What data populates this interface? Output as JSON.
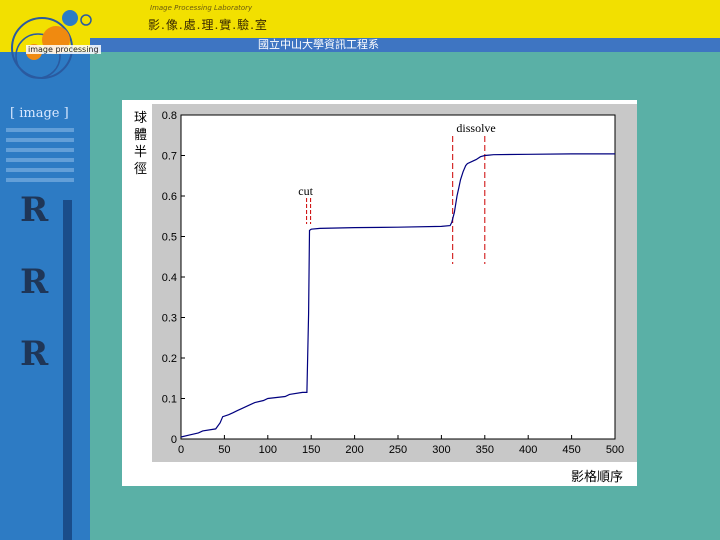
{
  "header": {
    "title": "影.像.處.理.實.驗.室",
    "subtitle": "Image Processing Laboratory",
    "department": "國立中山大學資訊工程系"
  },
  "logo": {
    "text": "image processing"
  },
  "sidebar": {
    "title": "[ image ]"
  },
  "colors": {
    "header": "#f2e000",
    "sidebar": "#2d7bc4",
    "background": "#5ab0a6",
    "curve": "#00007f",
    "markers": "#cc0000"
  },
  "chart_data": {
    "type": "line",
    "ylabel": "球體半徑",
    "xlabel": "影格順序",
    "xlim": [
      0,
      500
    ],
    "ylim": [
      0,
      0.8
    ],
    "xticks": [
      "0",
      "50",
      "100",
      "150",
      "200",
      "250",
      "300",
      "350",
      "400",
      "450",
      "500"
    ],
    "yticks": [
      "0",
      "0.1",
      "0.2",
      "0.3",
      "0.4",
      "0.5",
      "0.6",
      "0.7",
      "0.8"
    ],
    "grid": false,
    "series": [
      {
        "x": [
          0,
          10,
          20,
          25,
          40,
          45,
          48,
          55,
          60,
          65,
          70,
          80,
          85,
          95,
          100,
          120,
          125,
          140,
          145,
          147,
          148,
          150,
          160,
          200,
          250,
          300,
          310,
          312,
          315,
          318,
          320,
          322,
          325,
          328,
          330,
          335,
          340,
          345,
          350,
          355,
          360,
          400,
          450,
          500
        ],
        "y": [
          0.005,
          0.01,
          0.015,
          0.02,
          0.025,
          0.04,
          0.055,
          0.06,
          0.065,
          0.07,
          0.075,
          0.085,
          0.09,
          0.095,
          0.1,
          0.105,
          0.11,
          0.115,
          0.115,
          0.31,
          0.515,
          0.518,
          0.52,
          0.522,
          0.523,
          0.525,
          0.527,
          0.535,
          0.56,
          0.6,
          0.62,
          0.64,
          0.66,
          0.675,
          0.68,
          0.685,
          0.69,
          0.697,
          0.7,
          0.701,
          0.702,
          0.703,
          0.704,
          0.704
        ]
      }
    ],
    "annotations": [
      {
        "text": "cut",
        "x": 147,
        "lines": [
          147
        ]
      },
      {
        "text": "dissolve",
        "x": 315,
        "lines": [
          313,
          350
        ]
      }
    ]
  }
}
